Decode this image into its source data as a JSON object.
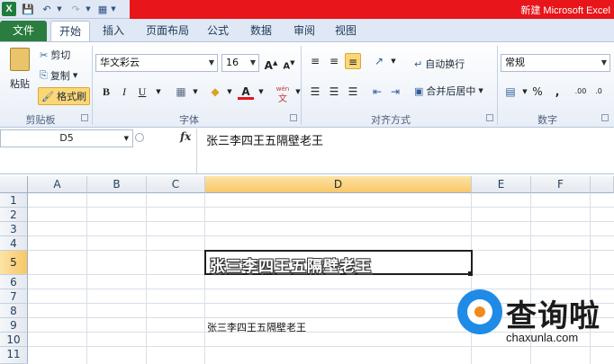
{
  "window": {
    "title": "新建 Microsoft Excel",
    "logo": "X"
  },
  "tabs": [
    "文件",
    "开始",
    "插入",
    "页面布局",
    "公式",
    "数据",
    "审阅",
    "视图"
  ],
  "ribbon": {
    "clipboard": {
      "paste": "粘贴",
      "cut": "剪切",
      "copy": "复制",
      "format_painter": "格式刷",
      "label": "剪贴板"
    },
    "font": {
      "name": "华文彩云",
      "size": "16",
      "label": "字体",
      "phonetic": "wén"
    },
    "alignment": {
      "wrap_text": "自动换行",
      "merge_center": "合并后居中",
      "label": "对齐方式"
    },
    "number": {
      "format": "常规",
      "label": "数字",
      "percent": "%",
      "comma": ","
    }
  },
  "formula_bar": {
    "name_box": "D5",
    "fx": "fx",
    "formula": "张三李四王五隔壁老王"
  },
  "grid": {
    "columns": [
      "A",
      "B",
      "C",
      "D",
      "E",
      "F"
    ],
    "rows": [
      "1",
      "2",
      "3",
      "4",
      "5",
      "6",
      "7",
      "8",
      "9",
      "10",
      "11"
    ],
    "selected_cell": "D5",
    "cell_D5": "张三李四王五隔壁老王",
    "cell_D9": "张三李四王五隔壁老王"
  },
  "watermark": {
    "brand": "查询啦",
    "url": "chaxunla.com"
  },
  "colors": {
    "accent_red": "#e8151b",
    "file_tab": "#2a7d3e",
    "selection": "#f8c766",
    "logo_blue": "#1f8be6",
    "logo_orange": "#f08b1a"
  }
}
